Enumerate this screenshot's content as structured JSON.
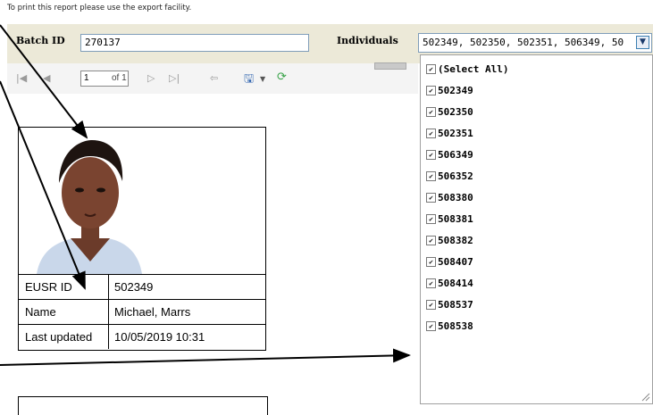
{
  "report": {
    "notice": "To print this report please use the export facility."
  },
  "params": {
    "batch_label": "Batch ID",
    "batch_value": "270137",
    "individuals_label": "Individuals",
    "individuals_value": "502349, 502350, 502351, 506349, 50"
  },
  "toolbar": {
    "page_value": "1",
    "of_label": "of 1"
  },
  "dropdown": {
    "items": [
      {
        "label": "(Select All)",
        "checked": true
      },
      {
        "label": "502349",
        "checked": true
      },
      {
        "label": "502350",
        "checked": true
      },
      {
        "label": "502351",
        "checked": true
      },
      {
        "label": "506349",
        "checked": true
      },
      {
        "label": "506352",
        "checked": true
      },
      {
        "label": "508380",
        "checked": true
      },
      {
        "label": "508381",
        "checked": true
      },
      {
        "label": "508382",
        "checked": true
      },
      {
        "label": "508407",
        "checked": true
      },
      {
        "label": "508414",
        "checked": true
      },
      {
        "label": "508537",
        "checked": true
      },
      {
        "label": "508538",
        "checked": true
      }
    ]
  },
  "card": {
    "rows": [
      {
        "key": "EUSR ID",
        "value": "502349"
      },
      {
        "key": "Name",
        "value": "Michael, Marrs"
      },
      {
        "key": "Last updated",
        "value": "10/05/2019 10:31"
      }
    ]
  }
}
